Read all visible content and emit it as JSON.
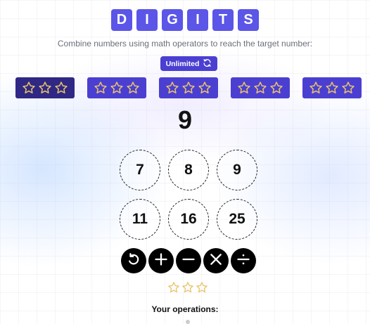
{
  "title": {
    "letters": [
      "D",
      "I",
      "G",
      "I",
      "T",
      "S"
    ]
  },
  "subtitle": "Combine numbers using math operators to reach the target number:",
  "mode": {
    "label": "Unlimited",
    "icon": "refresh-icon"
  },
  "levels": [
    {
      "stars_earned": 0,
      "stars_total": 3,
      "active": true
    },
    {
      "stars_earned": 0,
      "stars_total": 3,
      "active": false
    },
    {
      "stars_earned": 0,
      "stars_total": 3,
      "active": false
    },
    {
      "stars_earned": 0,
      "stars_total": 3,
      "active": false
    },
    {
      "stars_earned": 0,
      "stars_total": 3,
      "active": false
    }
  ],
  "target": "9",
  "numbers": [
    "7",
    "8",
    "9",
    "11",
    "16",
    "25"
  ],
  "operations": [
    {
      "name": "undo",
      "icon": "undo-icon"
    },
    {
      "name": "add",
      "icon": "plus-icon"
    },
    {
      "name": "subtract",
      "icon": "minus-icon"
    },
    {
      "name": "multiply",
      "icon": "times-icon"
    },
    {
      "name": "divide",
      "icon": "divide-icon"
    }
  ],
  "result_stars": {
    "earned": 0,
    "total": 3
  },
  "operations_label": "Your operations:",
  "colors": {
    "tile": "#5b55e8",
    "button": "#4b3fd2",
    "active_level": "#2f2885",
    "star_outline": "#e9c46a",
    "op_button": "#000000"
  }
}
